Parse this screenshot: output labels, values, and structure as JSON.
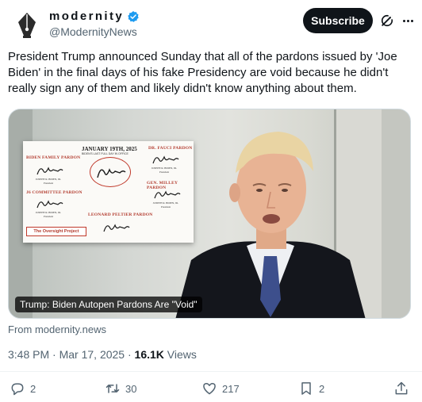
{
  "author": {
    "display_name": "modernity",
    "handle": "@ModernityNews",
    "avatar_icon": "pen-nib-logo",
    "verified_icon": "verified-badge-icon",
    "verified_color": "#1d9bf0"
  },
  "header": {
    "subscribe_label": "Subscribe",
    "grok_icon": "grok-icon",
    "more_icon": "more-icon"
  },
  "tweet": {
    "text": "President Trump announced Sunday that all of the pardons issued by 'Joe Biden' in the final days of his fake Presidency are void because he didn't really sign any of them and likely didn't know anything about them."
  },
  "media": {
    "caption": "Trump: Biden Autopen Pardons Are \"Void\"",
    "document": {
      "date": "JANUARY 19TH, 2025",
      "subtitle": "BIDEN'S LAST FULL DAY IN OFFICE",
      "label_left_top": "BIDEN FAMILY PARDON",
      "label_right_top": "DR. FAUCI PARDON",
      "label_left_mid": "J6 COMMITTEE PARDON",
      "label_right_mid": "GEN. MILLEY PARDON",
      "label_bottom_center": "LEONARD PELTIER PARDON",
      "signer_name": "JOSEPH R. BIDEN, JR.",
      "signer_title": "President",
      "source_label": "The Oversight Project"
    }
  },
  "source": "From modernity.news",
  "meta": {
    "time": "3:48 PM",
    "separator": "·",
    "date": "Mar 17, 2025",
    "views_count": "16.1K",
    "views_label": "Views"
  },
  "actions": {
    "reply": {
      "icon": "reply-icon",
      "count": "2"
    },
    "retweet": {
      "icon": "retweet-icon",
      "count": "30"
    },
    "like": {
      "icon": "heart-icon",
      "count": "217"
    },
    "bookmark": {
      "icon": "bookmark-icon",
      "count": "2"
    },
    "share": {
      "icon": "share-icon"
    }
  },
  "colors": {
    "text": "#0f1419",
    "secondary": "#536471",
    "accent_red": "#b23a2d",
    "border": "#cfd9de"
  }
}
